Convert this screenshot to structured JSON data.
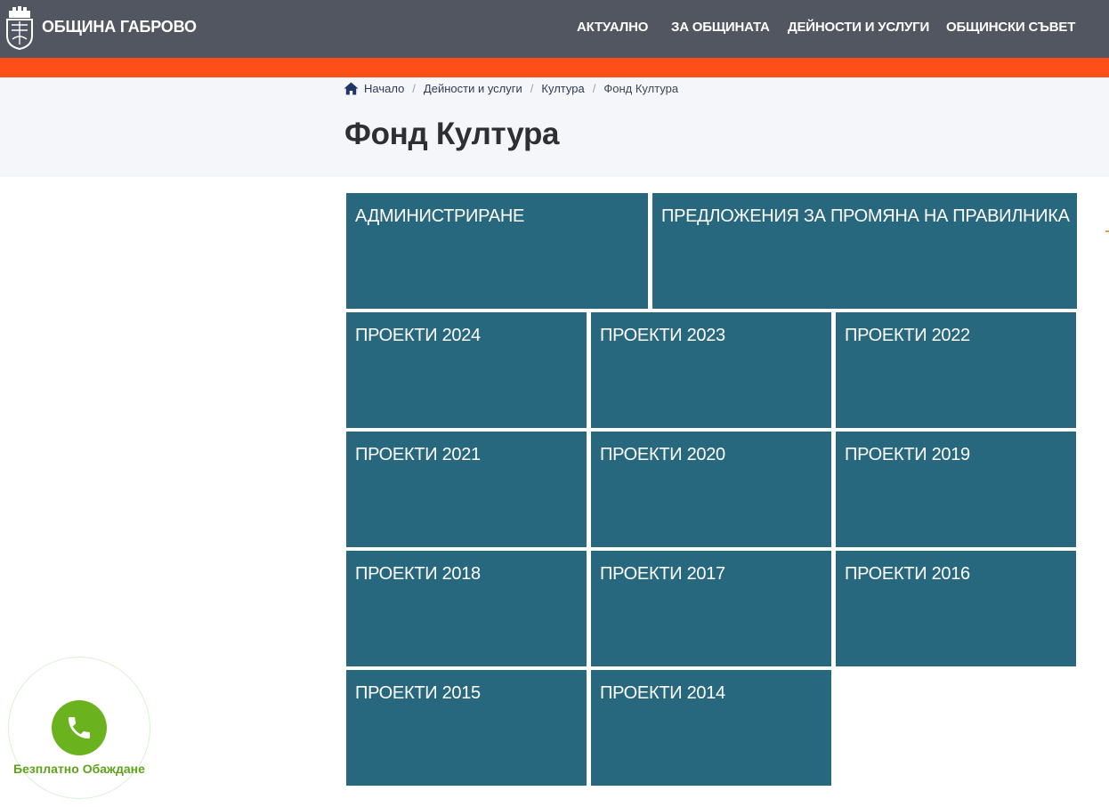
{
  "header": {
    "brand": "ОБЩИНА ГАБРОВО",
    "logo_icon": "coat-of-arms-icon",
    "nav": [
      "АКТУАЛНО",
      "ЗА ОБЩИНАТА",
      "ДЕЙНОСТИ И УСЛУГИ",
      "ОБЩИНСКИ СЪВЕТ"
    ]
  },
  "breadcrumb": {
    "home_icon": "home-icon",
    "items": [
      "Начало",
      "Дейности и услуги",
      "Култура"
    ],
    "current": "Фонд Култура",
    "separator": "/"
  },
  "page": {
    "title": "Фонд Култура"
  },
  "tiles": [
    "АДМИНИСТРИРАНЕ",
    "ПРЕДЛОЖЕНИЯ ЗА ПРОМЯНА НА ПРАВИЛНИКА",
    "ПРОЕКТИ 2024",
    "ПРОЕКТИ 2023",
    "ПРОЕКТИ 2022",
    "ПРОЕКТИ 2021",
    "ПРОЕКТИ 2020",
    "ПРОЕКТИ 2019",
    "ПРОЕКТИ 2018",
    "ПРОЕКТИ 2017",
    "ПРОЕКТИ 2016",
    "ПРОЕКТИ 2015",
    "ПРОЕКТИ 2014"
  ],
  "call_widget": {
    "label": "Безплатно Обаждане",
    "icon": "phone-icon"
  },
  "colors": {
    "header_bg": "#525660",
    "accent": "#ff4f19",
    "hero_bg": "#f5f6fa",
    "tile_bg": "#28687f",
    "call_green": "#6ab31f"
  }
}
